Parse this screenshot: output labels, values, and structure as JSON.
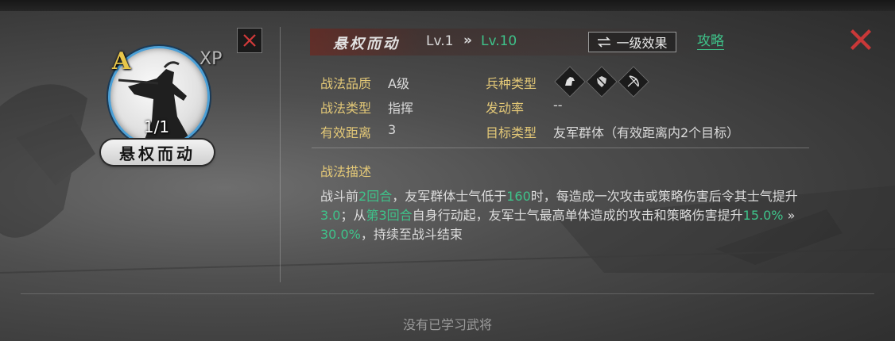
{
  "hero_card": {
    "grade": "A",
    "xp_label": "XP",
    "count": "1/1",
    "skill_name": "悬权而动",
    "portrait_icon": "warrior-silhouette-icon",
    "close_icon": "close-x-icon",
    "accent_color": "#4a9fd6"
  },
  "header": {
    "title": "悬权而动",
    "level_current": "Lv.1",
    "level_arrow": "»",
    "level_max": "Lv.10",
    "effect_button_icon": "swap-arrows-icon",
    "effect_button_label": "一级效果",
    "guide_label": "攻略",
    "close_icon": "close-x-icon"
  },
  "attributes": {
    "quality_label": "战法品质",
    "quality_value": "A级",
    "type_label": "战法类型",
    "type_value": "指挥",
    "range_label": "有效距离",
    "range_value": "3",
    "troop_label": "兵种类型",
    "troop_icons": [
      "cavalry-icon",
      "shield-icon",
      "bow-icon"
    ],
    "trigger_label": "发动率",
    "trigger_value": "--",
    "target_label": "目标类型",
    "target_value": "友军群体（有效距离内2个目标）"
  },
  "description": {
    "heading": "战法描述",
    "seg1": "战斗前",
    "seg2": "2回合",
    "seg3": "，友军群体士气低于",
    "seg4": "160",
    "seg5": "时，每造成一次攻击或策略伤害后令其士气提升",
    "seg6": "3.0",
    "seg7": "；从",
    "seg8": "第3回合",
    "seg9": "自身行动起，友军士气最高单体造成的攻击和策略伤害提升",
    "seg10": "15.0%",
    "seg11": " » ",
    "seg12": "30.0%",
    "seg13": "，持续至战斗结束"
  },
  "footer": {
    "note": "没有已学习武将"
  },
  "colors": {
    "highlight_green": "#3ec38a",
    "label_gold": "#e3c877",
    "close_red": "#d23a3a"
  }
}
